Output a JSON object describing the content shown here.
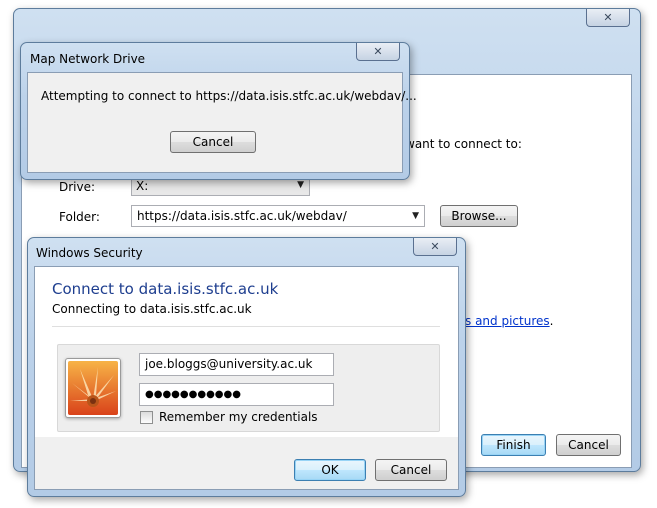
{
  "map_drive_wizard": {
    "close_glyph": "✕",
    "instruction_partial": "want to connect to:",
    "drive_label": "Drive:",
    "drive_value": "X:",
    "folder_label": "Folder:",
    "folder_value": "https://data.isis.stfc.ac.uk/webdav/",
    "browse_label": "Browse...",
    "link_partial": "s and pictures",
    "link_suffix": ".",
    "finish_label": "Finish",
    "cancel_label": "Cancel"
  },
  "progress_dialog": {
    "title": "Map Network Drive",
    "close_glyph": "✕",
    "message": "Attempting to connect to https://data.isis.stfc.ac.uk/webdav/...",
    "cancel_label": "Cancel"
  },
  "security_dialog": {
    "title": "Windows Security",
    "close_glyph": "✕",
    "heading": "Connect to data.isis.stfc.ac.uk",
    "subheading": "Connecting to data.isis.stfc.ac.uk",
    "username_value": "joe.bloggs@university.ac.uk",
    "password_value": "●●●●●●●●●●●",
    "remember_label": "Remember my credentials",
    "remember_checked": false,
    "ok_label": "OK",
    "cancel_label": "Cancel"
  },
  "colors": {
    "heading_blue": "#1e3e8f",
    "link_blue": "#0033cc"
  }
}
